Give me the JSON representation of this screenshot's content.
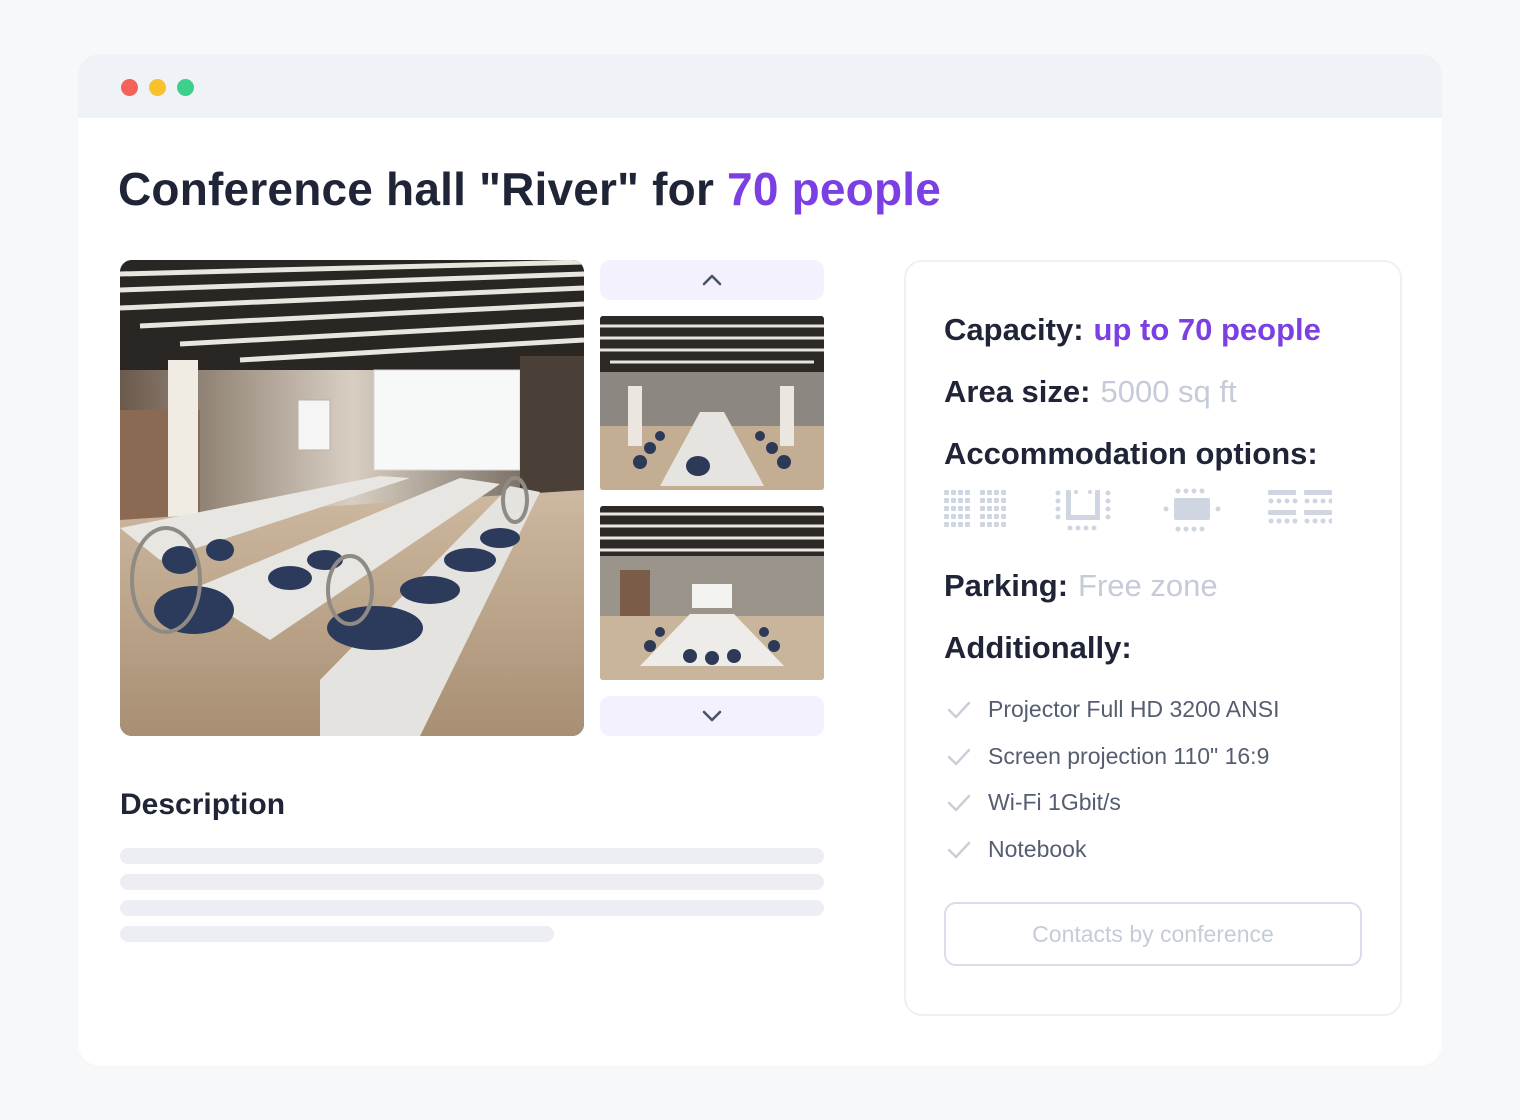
{
  "window": {
    "controls": [
      "close",
      "minimize",
      "maximize"
    ]
  },
  "title": {
    "prefix": "Conference hall \"River\"  for ",
    "accent": "70 people"
  },
  "gallery": {
    "main_photo": "conference-room-photo",
    "thumbnails": [
      "conference-room-thumb-1",
      "conference-room-thumb-2"
    ],
    "prev_icon": "chevron-up-icon",
    "next_icon": "chevron-down-icon"
  },
  "description": {
    "title": "Description"
  },
  "details": {
    "capacity_label": "Capacity:",
    "capacity_value": "up to 70 people",
    "area_label": "Area size:",
    "area_value": "5000 sq ft",
    "accommodation_label": "Accommodation options:",
    "accommodation_icons": [
      "classroom-layout-icon",
      "u-shape-layout-icon",
      "boardroom-layout-icon",
      "theater-layout-icon"
    ],
    "parking_label": "Parking:",
    "parking_value": "Free zone",
    "additionally_label": "Additionally:",
    "amenities": [
      "Projector Full HD 3200 ANSI",
      "Screen projection 110\" 16:9",
      "Wi-Fi 1Gbit/s",
      "Notebook"
    ],
    "contact_button": "Contacts by conference"
  },
  "colors": {
    "accent": "#7b3fe4",
    "heading": "#1f2537",
    "muted": "#c5cbd8",
    "icon": "#cfd5e1"
  }
}
